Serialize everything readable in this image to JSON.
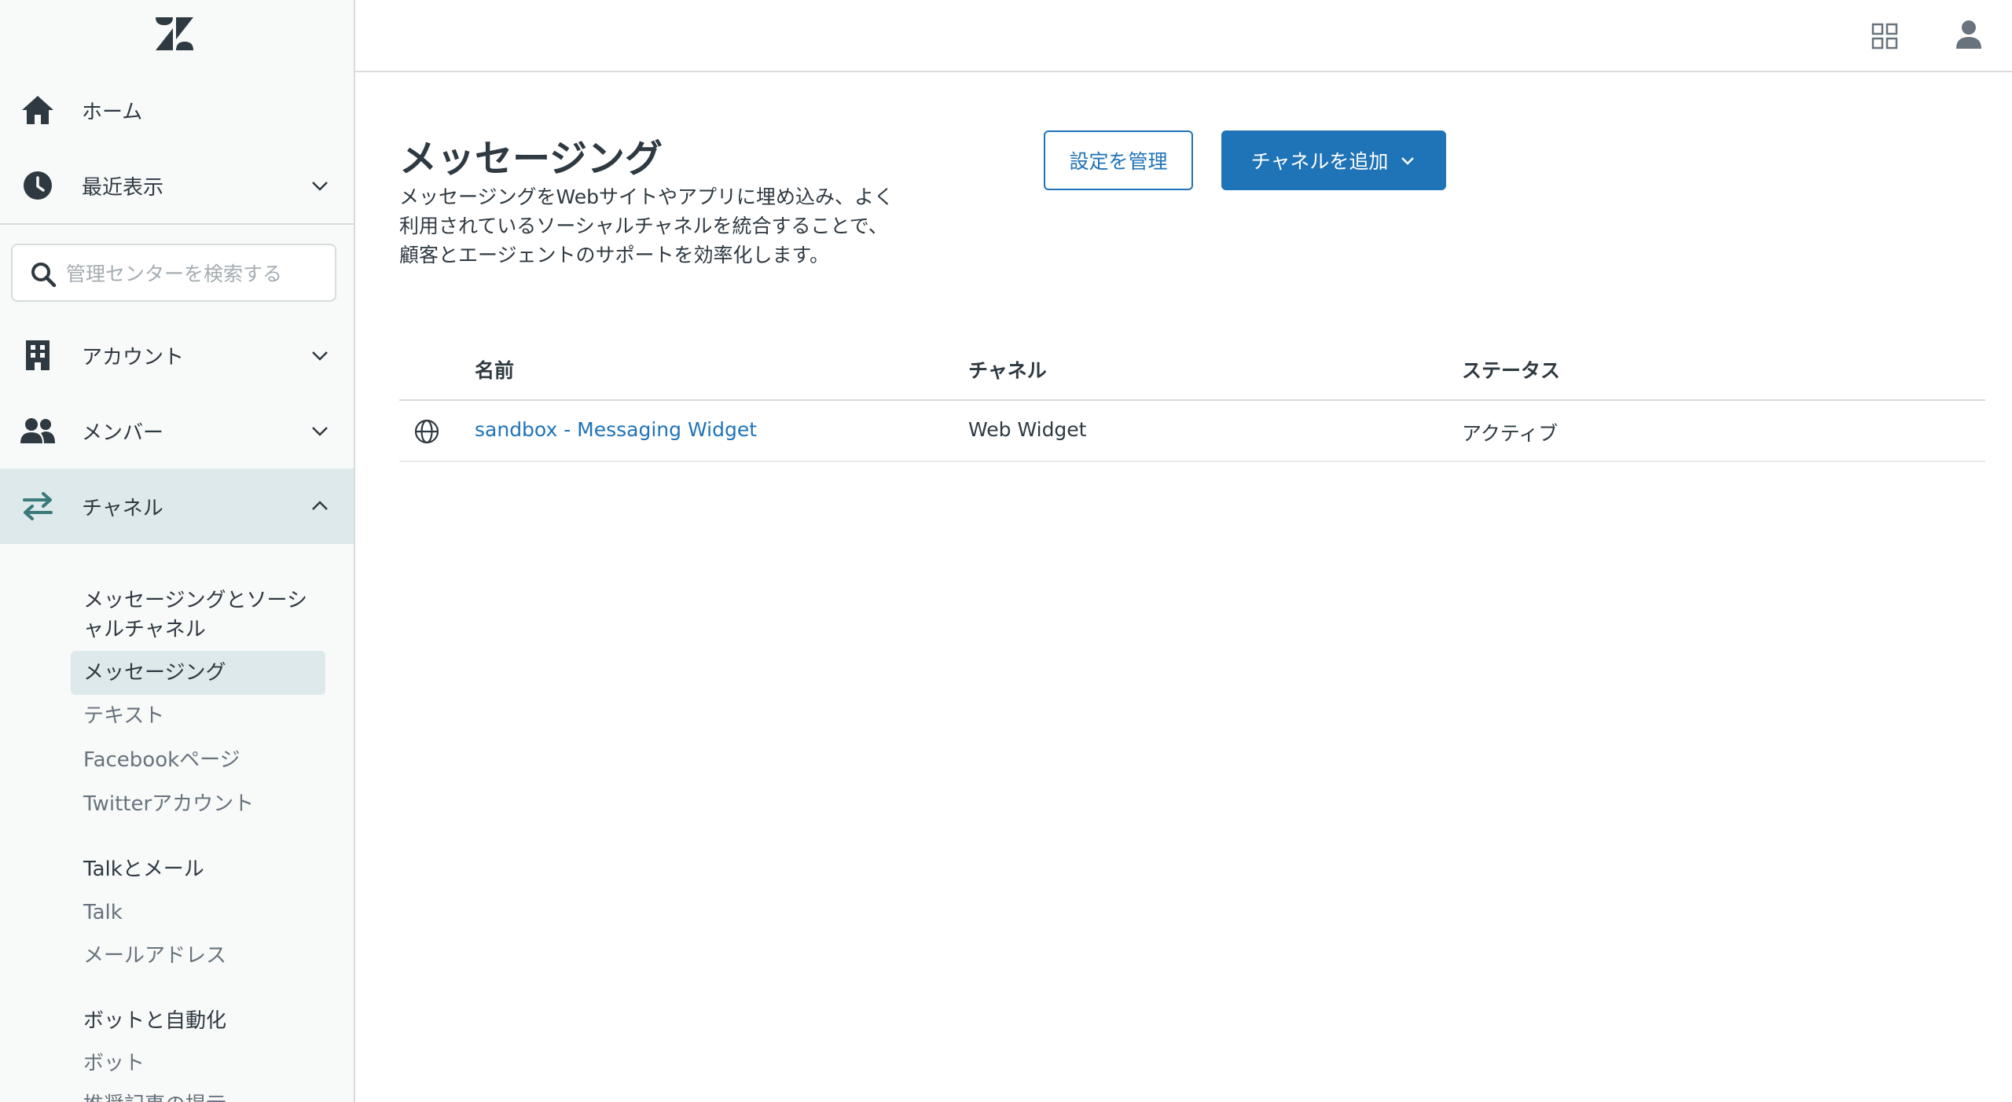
{
  "sidebar": {
    "logo": "zendesk-logo",
    "home": {
      "label": "ホーム",
      "icon": "home-icon"
    },
    "recent": {
      "label": "最近表示",
      "icon": "clock-icon"
    },
    "search": {
      "placeholder": "管理センターを検索する",
      "icon": "search-icon"
    },
    "account": {
      "label": "アカウント",
      "icon": "building-icon"
    },
    "members": {
      "label": "メンバー",
      "icon": "people-icon"
    },
    "channels": {
      "label": "チャネル",
      "icon": "arrows-swap-icon"
    },
    "groups": [
      {
        "heading": "メッセージングとソーシャルチャネル",
        "heading_line1": "メッセージングとソーシ",
        "heading_line2": "ャルチャネル",
        "items": [
          "メッセージング",
          "テキスト",
          "Facebookページ",
          "Twitterアカウント"
        ]
      },
      {
        "heading": "Talkとメール",
        "items": [
          "Talk",
          "メールアドレス"
        ]
      },
      {
        "heading": "ボットと自動化",
        "items": [
          "ボット",
          "推奨記事の提示"
        ]
      }
    ]
  },
  "header": {
    "apps_icon": "apps-grid-icon",
    "user_icon": "user-icon"
  },
  "main": {
    "title": "メッセージング",
    "description": "メッセージングをWebサイトやアプリに埋め込み、よく利用されているソーシャルチャネルを統合することで、顧客とエージェントのサポートを効率化します。",
    "manage_button": "設定を管理",
    "add_button": "チャネルを追加",
    "table": {
      "headers": [
        "名前",
        "チャネル",
        "ステータス"
      ],
      "rows": [
        {
          "icon": "globe-icon",
          "name": "sandbox - Messaging Widget",
          "channel": "Web Widget",
          "status": "アクティブ"
        }
      ]
    }
  },
  "colors": {
    "accent": "#1f73b7",
    "sidebar_bg": "#f8f9f9",
    "active_bg": "#dde9ea",
    "text": "#2f3941",
    "muted": "#68737d",
    "channel_icon": "#3b7a7b"
  }
}
